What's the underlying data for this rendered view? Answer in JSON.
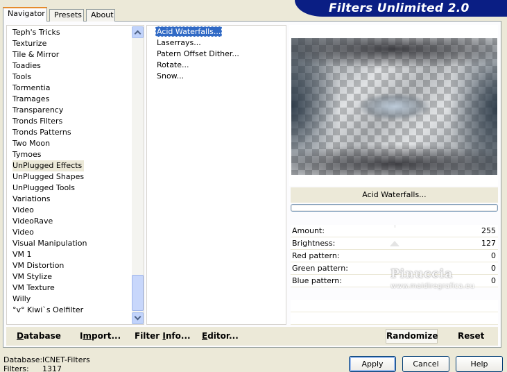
{
  "header": {
    "title": "Filters Unlimited 2.0"
  },
  "tabs": [
    {
      "label": "Navigator",
      "active": true
    },
    {
      "label": "Presets",
      "active": false
    },
    {
      "label": "About",
      "active": false
    }
  ],
  "categories": {
    "items": [
      "Teph's Tricks",
      "Texturize",
      "Tile & Mirror",
      "Toadies",
      "Tools",
      "Tormentia",
      "Tramages",
      "Transparency",
      "Tronds Filters",
      "Tronds Patterns",
      "Two Moon",
      "Tymoes",
      "UnPlugged Effects",
      "UnPlugged Shapes",
      "UnPlugged Tools",
      "Variations",
      "Video",
      "VideoRave",
      "Video",
      "Visual Manipulation",
      "VM 1",
      "VM Distortion",
      "VM Stylize",
      "VM Texture",
      "Willy",
      "°v° Kiwi`s Oelfilter"
    ],
    "selected": "UnPlugged Effects"
  },
  "filters": {
    "items": [
      "Acid Waterfalls...",
      "Laserrays...",
      "Patern Offset Dither...",
      "Rotate...",
      "Snow..."
    ],
    "selected": "Acid Waterfalls..."
  },
  "preview": {
    "filter_name": "Acid Waterfalls..."
  },
  "params": [
    {
      "label": "Amount:",
      "value": "255"
    },
    {
      "label": "Brightness:",
      "value": "127"
    },
    {
      "label": "Red pattern:",
      "value": "0"
    },
    {
      "label": "Green pattern:",
      "value": "0"
    },
    {
      "label": "Blue pattern:",
      "value": "0"
    }
  ],
  "watermark": {
    "line1": "Pinuccia",
    "line2": "www.maidiregrafica.eu"
  },
  "toolbar": {
    "database": {
      "first": "D",
      "rest": "atabase"
    },
    "import": {
      "first": "I",
      "mid": "mport...",
      "u": "m"
    },
    "filter_info": {
      "first": "Filter ",
      "u": "I",
      "rest": "nfo..."
    },
    "editor": {
      "first": "E",
      "rest": "ditor..."
    },
    "randomize": "Randomize",
    "reset": "Reset"
  },
  "status": {
    "database_label": "Database:",
    "database_value": "ICNET-Filters",
    "filters_label": "Filters:",
    "filters_value": "1317"
  },
  "buttons": {
    "apply": "Apply",
    "cancel": "Cancel",
    "help": "Help"
  },
  "colors": {
    "banner": "#0a1e84",
    "selection": "#316ac5",
    "dialog": "#ece9d8"
  }
}
